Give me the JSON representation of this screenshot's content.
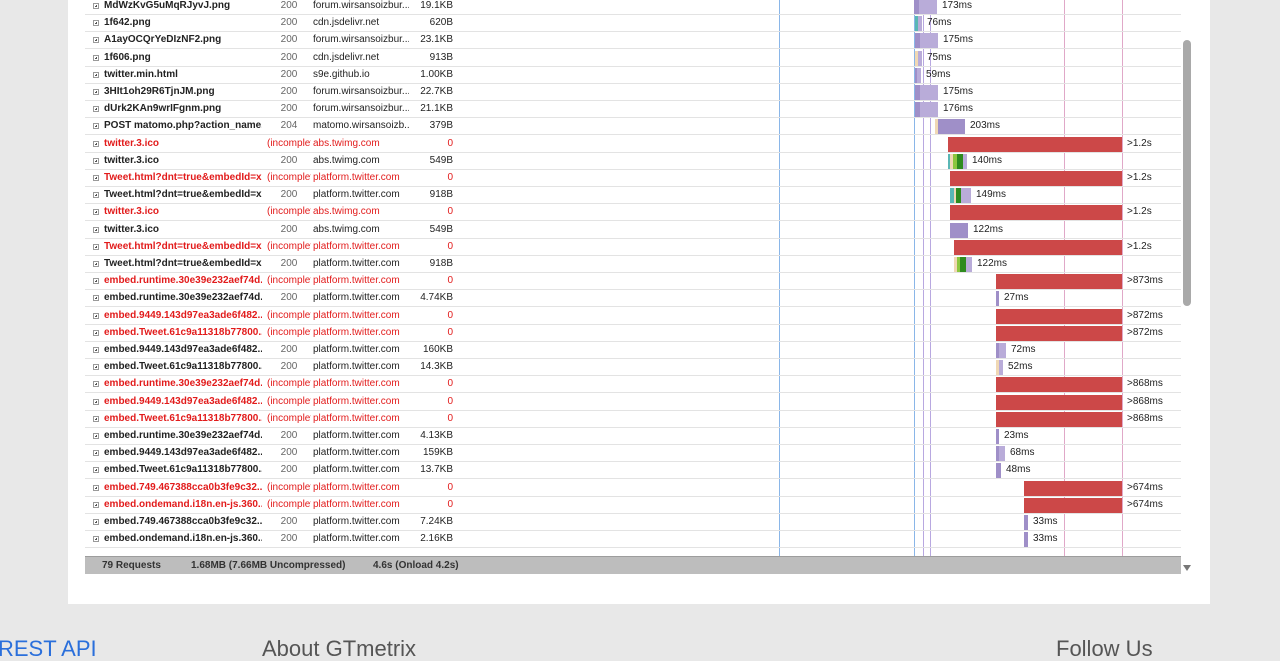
{
  "rows": [
    {
      "name": "MdWzKvG5uMqRJyvJ.png",
      "status": "200",
      "domain": "forum.wirsansoizbur...",
      "size": "19.1KB",
      "time": "173ms",
      "error": false
    },
    {
      "name": "1f642.png",
      "status": "200",
      "domain": "cdn.jsdelivr.net",
      "size": "620B",
      "time": "76ms",
      "error": false
    },
    {
      "name": "A1ayOCQrYeDIzNF2.png",
      "status": "200",
      "domain": "forum.wirsansoizbur...",
      "size": "23.1KB",
      "time": "175ms",
      "error": false
    },
    {
      "name": "1f606.png",
      "status": "200",
      "domain": "cdn.jsdelivr.net",
      "size": "913B",
      "time": "75ms",
      "error": false
    },
    {
      "name": "twitter.min.html",
      "status": "200",
      "domain": "s9e.github.io",
      "size": "1.00KB",
      "time": "59ms",
      "error": false
    },
    {
      "name": "3HIt1oh29R6TjnJM.png",
      "status": "200",
      "domain": "forum.wirsansoizbur...",
      "size": "22.7KB",
      "time": "175ms",
      "error": false
    },
    {
      "name": "dUrk2KAn9wrIFgnm.png",
      "status": "200",
      "domain": "forum.wirsansoizbur...",
      "size": "21.1KB",
      "time": "176ms",
      "error": false
    },
    {
      "name": "POST matomo.php?action_name...",
      "status": "204",
      "domain": "matomo.wirsansoizb...",
      "size": "379B",
      "time": "203ms",
      "error": false
    },
    {
      "name": "twitter.3.ico",
      "status": "(incomplete)",
      "domain": "abs.twimg.com",
      "size": "0",
      "time": ">1.2s",
      "error": true
    },
    {
      "name": "twitter.3.ico",
      "status": "200",
      "domain": "abs.twimg.com",
      "size": "549B",
      "time": "140ms",
      "error": false
    },
    {
      "name": "Tweet.html?dnt=true&embedId=x...",
      "status": "(incomplete)",
      "domain": "platform.twitter.com",
      "size": "0",
      "time": ">1.2s",
      "error": true
    },
    {
      "name": "Tweet.html?dnt=true&embedId=x...",
      "status": "200",
      "domain": "platform.twitter.com",
      "size": "918B",
      "time": "149ms",
      "error": false
    },
    {
      "name": "twitter.3.ico",
      "status": "(incomplete)",
      "domain": "abs.twimg.com",
      "size": "0",
      "time": ">1.2s",
      "error": true
    },
    {
      "name": "twitter.3.ico",
      "status": "200",
      "domain": "abs.twimg.com",
      "size": "549B",
      "time": "122ms",
      "error": false
    },
    {
      "name": "Tweet.html?dnt=true&embedId=x...",
      "status": "(incomplete)",
      "domain": "platform.twitter.com",
      "size": "0",
      "time": ">1.2s",
      "error": true
    },
    {
      "name": "Tweet.html?dnt=true&embedId=x...",
      "status": "200",
      "domain": "platform.twitter.com",
      "size": "918B",
      "time": "122ms",
      "error": false
    },
    {
      "name": "embed.runtime.30e39e232aef74d...",
      "status": "(incomplete)",
      "domain": "platform.twitter.com",
      "size": "0",
      "time": ">873ms",
      "error": true
    },
    {
      "name": "embed.runtime.30e39e232aef74d...",
      "status": "200",
      "domain": "platform.twitter.com",
      "size": "4.74KB",
      "time": "27ms",
      "error": false
    },
    {
      "name": "embed.9449.143d97ea3ade6f482...",
      "status": "(incomplete)",
      "domain": "platform.twitter.com",
      "size": "0",
      "time": ">872ms",
      "error": true
    },
    {
      "name": "embed.Tweet.61c9a11318b77800...",
      "status": "(incomplete)",
      "domain": "platform.twitter.com",
      "size": "0",
      "time": ">872ms",
      "error": true
    },
    {
      "name": "embed.9449.143d97ea3ade6f482...",
      "status": "200",
      "domain": "platform.twitter.com",
      "size": "160KB",
      "time": "72ms",
      "error": false
    },
    {
      "name": "embed.Tweet.61c9a11318b77800...",
      "status": "200",
      "domain": "platform.twitter.com",
      "size": "14.3KB",
      "time": "52ms",
      "error": false
    },
    {
      "name": "embed.runtime.30e39e232aef74d...",
      "status": "(incomplete)",
      "domain": "platform.twitter.com",
      "size": "0",
      "time": ">868ms",
      "error": true
    },
    {
      "name": "embed.9449.143d97ea3ade6f482...",
      "status": "(incomplete)",
      "domain": "platform.twitter.com",
      "size": "0",
      "time": ">868ms",
      "error": true
    },
    {
      "name": "embed.Tweet.61c9a11318b77800...",
      "status": "(incomplete)",
      "domain": "platform.twitter.com",
      "size": "0",
      "time": ">868ms",
      "error": true
    },
    {
      "name": "embed.runtime.30e39e232aef74d...",
      "status": "200",
      "domain": "platform.twitter.com",
      "size": "4.13KB",
      "time": "23ms",
      "error": false
    },
    {
      "name": "embed.9449.143d97ea3ade6f482...",
      "status": "200",
      "domain": "platform.twitter.com",
      "size": "159KB",
      "time": "68ms",
      "error": false
    },
    {
      "name": "embed.Tweet.61c9a11318b77800...",
      "status": "200",
      "domain": "platform.twitter.com",
      "size": "13.7KB",
      "time": "48ms",
      "error": false
    },
    {
      "name": "embed.749.467388cca0b3fe9c32...",
      "status": "(incomplete)",
      "domain": "platform.twitter.com",
      "size": "0",
      "time": ">674ms",
      "error": true
    },
    {
      "name": "embed.ondemand.i18n.en-js.360...",
      "status": "(incomplete)",
      "domain": "platform.twitter.com",
      "size": "0",
      "time": ">674ms",
      "error": true
    },
    {
      "name": "embed.749.467388cca0b3fe9c32...",
      "status": "200",
      "domain": "platform.twitter.com",
      "size": "7.24KB",
      "time": "33ms",
      "error": false
    },
    {
      "name": "embed.ondemand.i18n.en-js.360...",
      "status": "200",
      "domain": "platform.twitter.com",
      "size": "2.16KB",
      "time": "33ms",
      "error": false
    }
  ],
  "summary": {
    "requests": "79 Requests",
    "size": "1.68MB  (7.66MB Uncompressed)",
    "time": "4.6s  (Onload 4.2s)"
  },
  "footer": {
    "api": "REST API",
    "about": "About GTmetrix",
    "follow": "Follow Us"
  },
  "colors": {
    "error_bar": "#cc4848",
    "wait": "#9f8fc8",
    "receive": "#b9acd9",
    "dns": "#5ab7b5",
    "connect": "#8cc63f",
    "ssl": "#2e8b1f",
    "blocking": "#f0d8b4",
    "error_text": "#e21b1b"
  }
}
